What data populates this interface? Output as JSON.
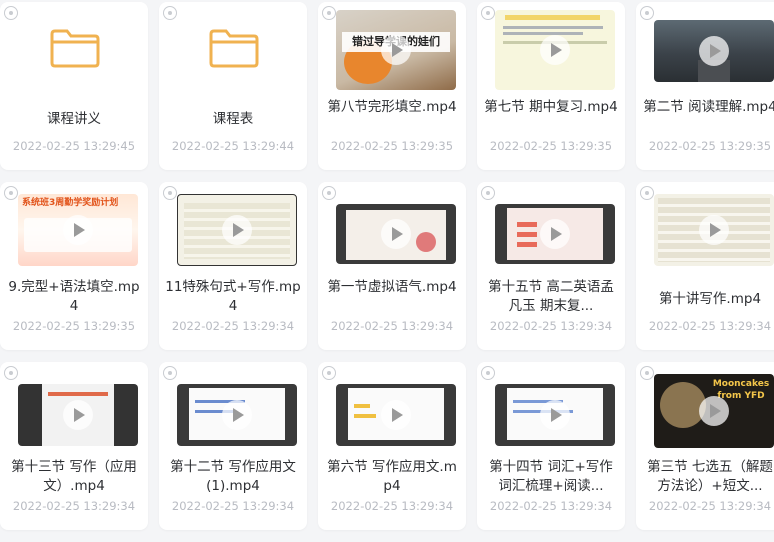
{
  "files": [
    {
      "name": "课程讲义",
      "date": "2022-02-25 13:29:45",
      "kind": "folder-icon"
    },
    {
      "name": "课程表",
      "date": "2022-02-25 13:29:44",
      "kind": "folder-icon"
    },
    {
      "name": "第八节完形填空.mp4",
      "date": "2022-02-25 13:29:35",
      "kind": "video",
      "thumb_text": "错过导学课的娃们"
    },
    {
      "name": "第七节 期中复习.mp4",
      "date": "2022-02-25 13:29:35",
      "kind": "video"
    },
    {
      "name": "第二节 阅读理解.mp4",
      "date": "2022-02-25 13:29:35",
      "kind": "video"
    },
    {
      "name": "9.完型+语法填空.mp4",
      "date": "2022-02-25 13:29:35",
      "kind": "video",
      "thumb_text": "系统班3周勤学奖励计划"
    },
    {
      "name": "11特殊句式+写作.mp4",
      "date": "2022-02-25 13:29:34",
      "kind": "video"
    },
    {
      "name": "第一节虚拟语气.mp4",
      "date": "2022-02-25 13:29:34",
      "kind": "video"
    },
    {
      "name": "第十五节 高二英语孟凡玉 期末复...",
      "date": "2022-02-25 13:29:34",
      "kind": "video"
    },
    {
      "name": "第十讲写作.mp4",
      "date": "2022-02-25 13:29:34",
      "kind": "video"
    },
    {
      "name": "第十三节 写作（应用文）.mp4",
      "date": "2022-02-25 13:29:34",
      "kind": "video"
    },
    {
      "name": "第十二节 写作应用文(1).mp4",
      "date": "2022-02-25 13:29:34",
      "kind": "video"
    },
    {
      "name": "第六节 写作应用文.mp4",
      "date": "2022-02-25 13:29:34",
      "kind": "video"
    },
    {
      "name": "第十四节 词汇+写作词汇梳理+阅读...",
      "date": "2022-02-25 13:29:34",
      "kind": "video"
    },
    {
      "name": "第三节 七选五（解题方法论）+短文...",
      "date": "2022-02-25 13:29:34",
      "kind": "video",
      "thumb_text": "Mooncakes from YFD"
    }
  ],
  "colors": {
    "folder": "#f5c16c",
    "folder_dark": "#f0b250",
    "date": "#b8bbc2",
    "name": "#2d2f33"
  }
}
